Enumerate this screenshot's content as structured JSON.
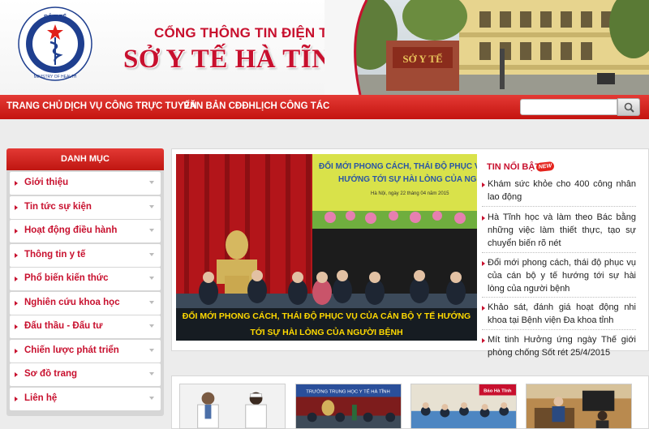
{
  "header": {
    "portal_title": "CỔNG THÔNG TIN ĐIỆN TỬ",
    "site_title": "SỞ Y TẾ HÀ TĨNH",
    "logo_top_text": "BỘ Y TẾ",
    "logo_bottom_text": "MINISTRY OF HEALTH",
    "photo_sign_text": "SỞ Y TẾ"
  },
  "nav": {
    "items": [
      "TRANG CHỦ",
      "DỊCH VỤ CÔNG TRỰC TUYẾN",
      "VĂN BẢN CĐĐH",
      "LỊCH CÔNG TÁC"
    ],
    "search_placeholder": ""
  },
  "sidebar": {
    "title": "DANH MỤC",
    "items": [
      "Giới thiệu",
      "Tin tức sự kiện",
      "Hoạt động điều hành",
      "Thông tin y tế",
      "Phổ biến kiến thức",
      "Nghiên cứu khoa học",
      "Đấu thầu - Đấu tư",
      "Chiến lược phát triển",
      "Sơ đồ trang",
      "Liên hệ"
    ]
  },
  "slideshow": {
    "banner_line1": "ĐỔI MỚI PHONG CÁCH, THÁI ĐỘ PHỤC VỤ CỦA CÁ",
    "banner_line2": "HƯỚNG TỚI SỰ HÀI LÒNG CỦA NGƯỜI BỆN",
    "banner_date": "Hà Nội, ngày 22 tháng 04 năm 2015",
    "caption": "ĐỔI MỚI PHONG CÁCH, THÁI ĐỘ PHỤC VỤ CỦA CÁN BỘ Y TẾ HƯỚNG TỚI SỰ HÀI LÒNG CỦA NGƯỜI BỆNH"
  },
  "hot_news": {
    "title": "TIN NỔI BẬT",
    "badge": "NEW",
    "items": [
      "Khám sức khỏe cho 400 công nhân lao động",
      "Hà Tĩnh học và làm theo Bác bằng những việc làm thiết thực, tạo sự chuyển biến rõ nét",
      "Đổi mới phong cách, thái độ phục vụ của cán bộ y tế hướng tới sự hài lòng của người bệnh",
      "Khảo sát, đánh giá hoạt động nhi khoa tại Bệnh viện Đa khoa tỉnh",
      "Mít tinh Hưởng ứng ngày Thế giới phòng chống Sốt rét 25/4/2015"
    ]
  },
  "thumbnails": {
    "thumb2_text": "TRƯỜNG TRUNG HỌC Y TẾ HÀ TĨNH",
    "thumb3_text": "Báo Hà Tĩnh"
  },
  "colors": {
    "brand_red": "#c8102e",
    "nav_red": "#d42520",
    "caption_yellow": "#ffd900"
  }
}
